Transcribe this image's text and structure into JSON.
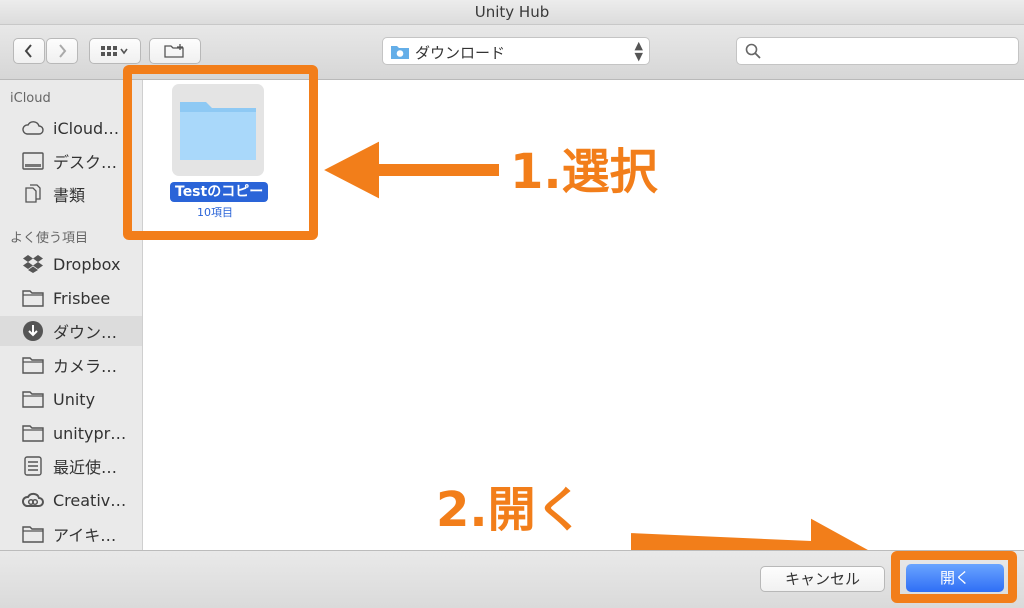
{
  "window": {
    "title": "Unity Hub"
  },
  "toolbar": {
    "back_icon": "chevron-left-icon",
    "forward_icon": "chevron-right-icon",
    "view_icon": "grid-view-icon",
    "new_folder_icon": "new-folder-icon",
    "location": "ダウンロード",
    "search_icon": "search-icon",
    "search_value": ""
  },
  "sidebar": {
    "sections": [
      {
        "title": "iCloud",
        "items": [
          {
            "label": "iCloud…",
            "icon": "cloud-icon"
          },
          {
            "label": "デスク…",
            "icon": "desktop-icon"
          },
          {
            "label": "書類",
            "icon": "document-icon"
          }
        ]
      },
      {
        "title": "よく使う項目",
        "items": [
          {
            "label": "Dropbox",
            "icon": "dropbox-icon"
          },
          {
            "label": "Frisbee",
            "icon": "folder-icon"
          },
          {
            "label": "ダウン…",
            "icon": "download-icon",
            "selected": true
          },
          {
            "label": "カメラ…",
            "icon": "folder-icon"
          },
          {
            "label": "Unity",
            "icon": "folder-icon"
          },
          {
            "label": "unitypr…",
            "icon": "folder-icon"
          },
          {
            "label": "最近使…",
            "icon": "recents-icon"
          },
          {
            "label": "Creativ…",
            "icon": "creative-cloud-icon"
          },
          {
            "label": "アイキ…",
            "icon": "folder-icon"
          }
        ]
      }
    ]
  },
  "content": {
    "items": [
      {
        "name": "Testのコピー",
        "subtitle": "10項目",
        "icon": "folder-icon",
        "selected": true
      }
    ]
  },
  "annotations": {
    "step1": "1.選択",
    "step2": "2.開く",
    "accent": "#f27e1a"
  },
  "footer": {
    "cancel_label": "キャンセル",
    "open_label": "開く"
  }
}
